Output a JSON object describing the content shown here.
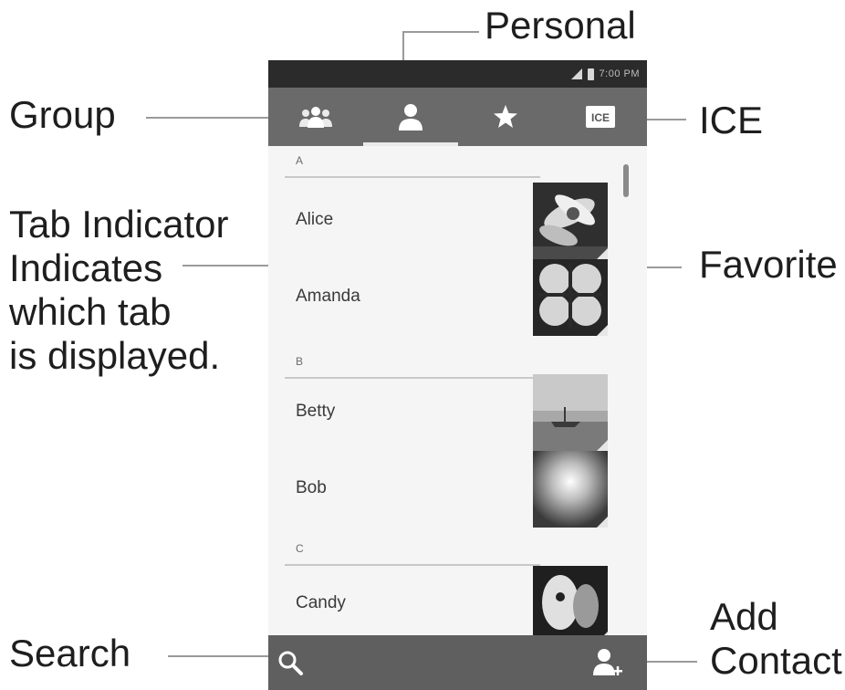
{
  "callouts": {
    "personal": "Personal",
    "group": "Group",
    "ice": "ICE",
    "tab_indicator": [
      "Tab Indicator",
      "Indicates",
      "which tab",
      "is displayed."
    ],
    "favorite": "Favorite",
    "search": "Search",
    "add_contact": [
      "Add",
      "Contact"
    ]
  },
  "phone": {
    "status_bar": {
      "clock": "7:00 PM",
      "icons": [
        "signal-icon",
        "battery-icon"
      ]
    },
    "tabs": [
      {
        "id": "group",
        "icon": "group-icon"
      },
      {
        "id": "personal",
        "icon": "person-icon",
        "selected": true
      },
      {
        "id": "favorite",
        "icon": "star-icon"
      },
      {
        "id": "ice",
        "icon": "ice-badge-icon",
        "label": "ICE"
      }
    ],
    "contacts": {
      "sections": [
        {
          "letter": "A",
          "contacts": [
            "Alice",
            "Amanda"
          ]
        },
        {
          "letter": "B",
          "contacts": [
            "Betty",
            "Bob"
          ]
        },
        {
          "letter": "C",
          "contacts": [
            "Candy"
          ]
        }
      ]
    },
    "bottom_bar": {
      "left_icon": "search-icon",
      "right_icon": "add-contact-icon"
    }
  },
  "colors": {
    "status_bar": "#2b2b2b",
    "action_bar": "#6a6a6a",
    "bottom_bar": "#5f5f5f",
    "tab_indicator": "#e9e9e9",
    "list_background": "#f5f5f5"
  }
}
